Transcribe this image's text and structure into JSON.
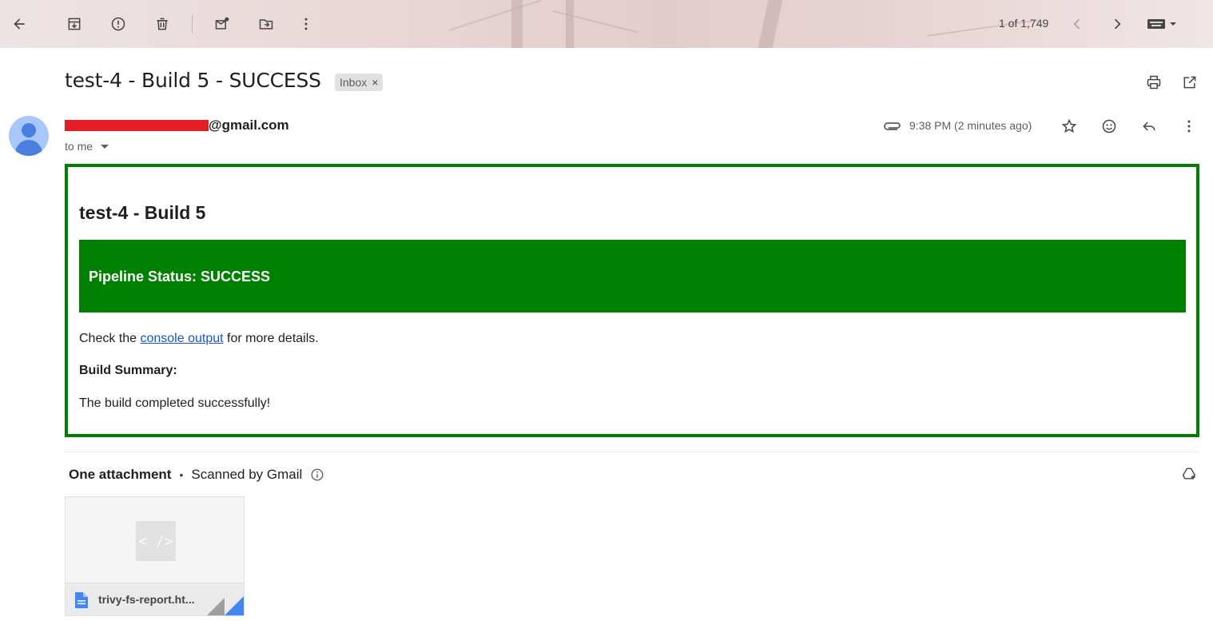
{
  "toolbar": {
    "counter": "1 of 1,749",
    "icons": [
      "back-arrow-icon",
      "archive-icon",
      "report-spam-icon",
      "delete-icon",
      "mark-unread-icon",
      "move-to-icon",
      "more-vert-icon",
      "chevron-left-icon",
      "chevron-right-icon",
      "keyboard-icon"
    ]
  },
  "email": {
    "subject": "test-4 - Build 5 - SUCCESS",
    "label": "Inbox",
    "label_remove": "×",
    "sender_suffix": "@gmail.com",
    "recipient": "to me",
    "time": "9:38 PM (2 minutes ago)"
  },
  "body": {
    "title": "test-4 - Build 5",
    "status": "Pipeline Status: SUCCESS",
    "check_prefix": "Check the ",
    "link_text": "console output",
    "check_suffix": " for more details.",
    "summary_heading": "Build Summary:",
    "summary_text": "The build completed successfully!",
    "colors": {
      "accent": "#008000",
      "link": "#1a57c6"
    }
  },
  "attachments": {
    "heading": "One attachment",
    "separator": "•",
    "scanned": "Scanned by Gmail",
    "file_name": "trivy-fs-report.ht...",
    "preview_glyph": "< />"
  }
}
